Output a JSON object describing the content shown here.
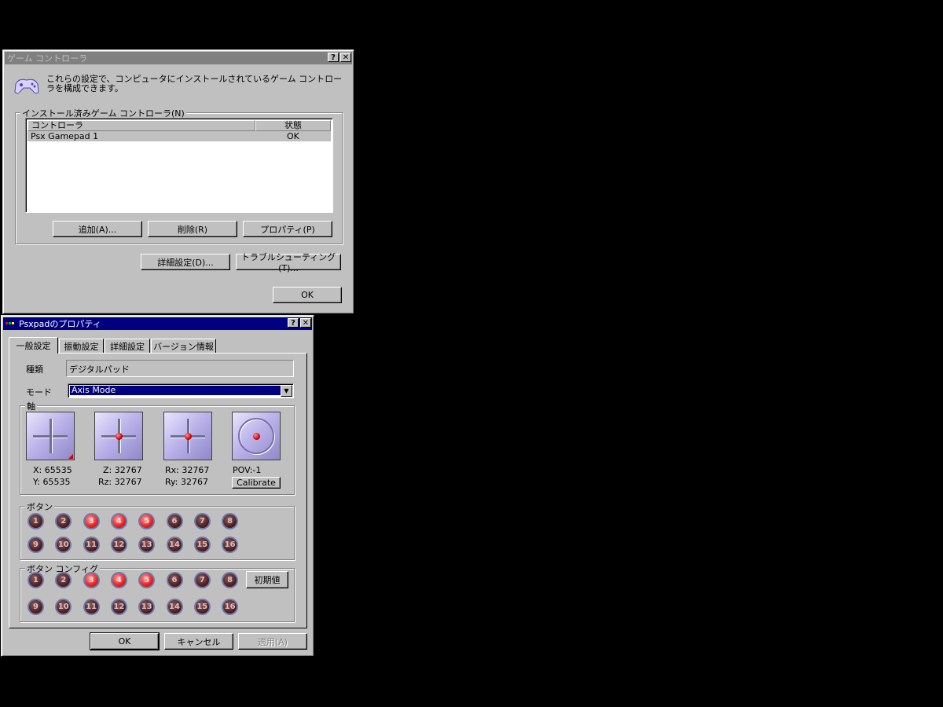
{
  "gc_window": {
    "title": "ゲーム コントローラ",
    "help_btn": "?",
    "close_btn": "✕",
    "description": "これらの設定で、コンピュータにインストールされているゲーム コントローラを構成できます。",
    "group_label": "インストール済みゲーム コントローラ(N)",
    "col_controller": "コントローラ",
    "col_status": "状態",
    "rows": [
      {
        "name": "Psx Gamepad 1",
        "status": "OK"
      }
    ],
    "add": "追加(A)...",
    "remove": "削除(R)",
    "properties": "プロパティ(P)",
    "advanced": "詳細設定(D)...",
    "troubleshoot": "トラブルシューティング(T)...",
    "ok": "OK"
  },
  "props_window": {
    "title": "Psxpadのプロパティ",
    "help_btn": "?",
    "close_btn": "✕",
    "tabs": [
      "一般設定",
      "振動設定",
      "詳細設定",
      "バージョン情報"
    ],
    "type_label": "種類",
    "type_value": "デジタルパッド",
    "mode_label": "モード",
    "mode_value": "Axis Mode",
    "axis_group": "軸",
    "x_line": "X:  65535",
    "y_line": "Y:  65535",
    "z_line": "Z:  32767",
    "rz_line": "Rz:  32767",
    "rx_line": "Rx:  32767",
    "ry_line": "Ry:  32767",
    "pov_line": "POV:-1",
    "calibrate": "Calibrate",
    "button_group": "ボタン",
    "button_config_group": "ボタン コンフィグ",
    "buttons": [
      "1",
      "2",
      "3",
      "4",
      "5",
      "6",
      "7",
      "8",
      "9",
      "10",
      "11",
      "12",
      "13",
      "14",
      "15",
      "16"
    ],
    "pressed": [
      3,
      4,
      5
    ],
    "default_btn": "初期値",
    "ok": "OK",
    "cancel": "キャンセル",
    "apply": "適用(A)"
  }
}
